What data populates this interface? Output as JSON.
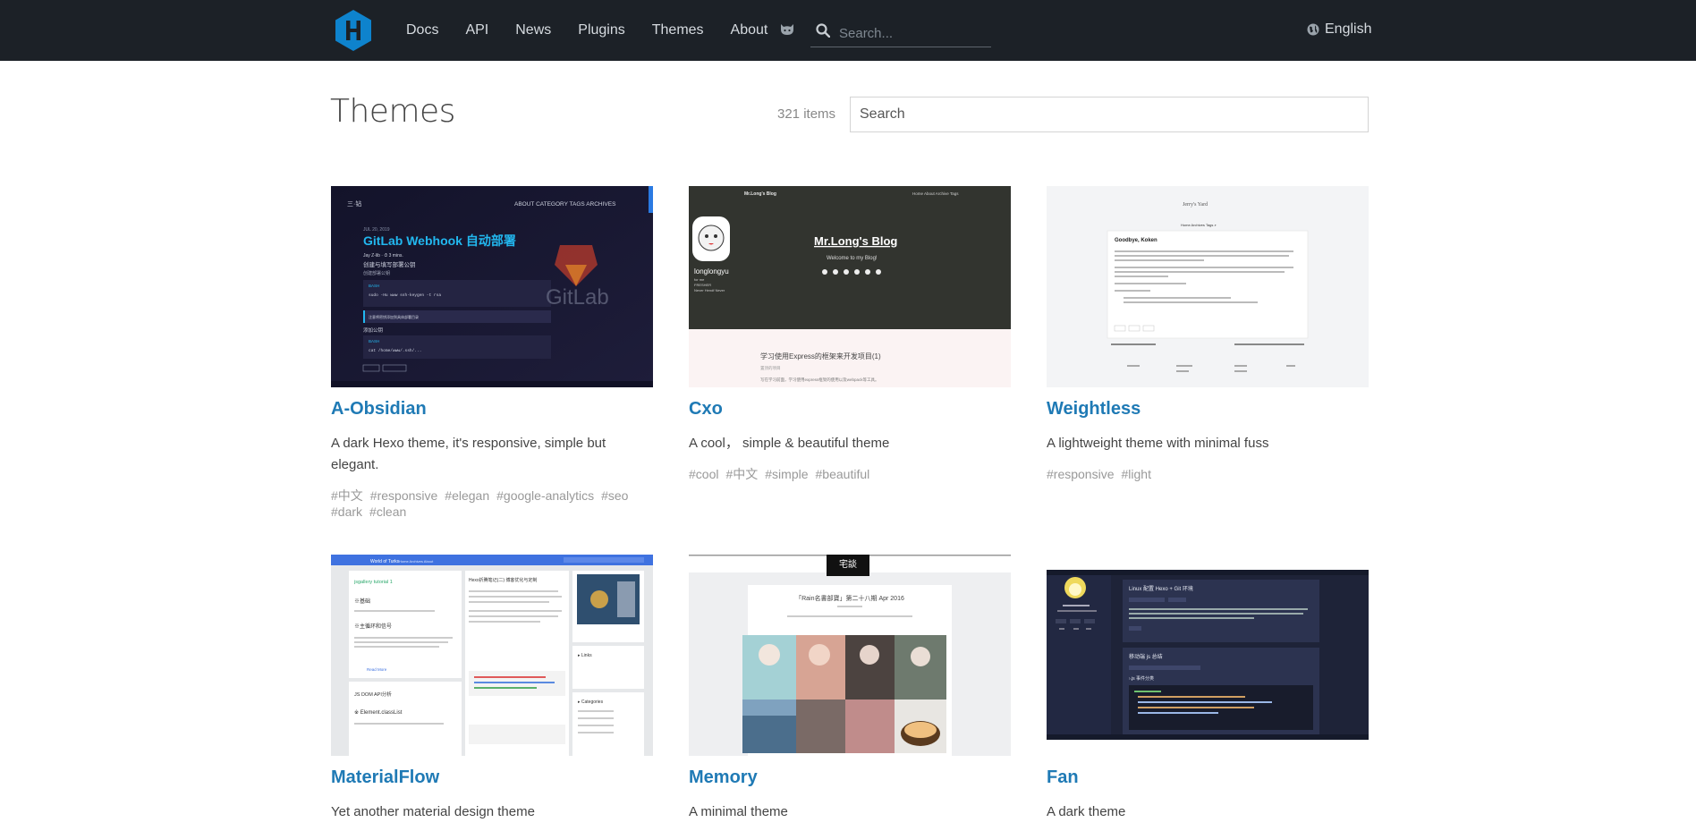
{
  "header": {
    "nav": [
      "Docs",
      "API",
      "News",
      "Plugins",
      "Themes",
      "About"
    ],
    "search_placeholder": "Search...",
    "language": "English"
  },
  "main": {
    "title": "Themes",
    "count": "321 items",
    "filter_placeholder": "Search"
  },
  "themes": [
    {
      "name": "A-Obsidian",
      "desc": "A dark Hexo theme, it's responsive, simple but elegant.",
      "tags": [
        "#中文",
        "#responsive",
        "#elegan",
        "#google-analytics",
        "#seo",
        "#dark",
        "#clean"
      ],
      "preview": {
        "nav": "ABOUT  CATEGORY  TAGS  ARCHIVES",
        "post_title": "GitLab Webhook 自动部署",
        "subtitle": "创建与填写部署公钥",
        "watermark": "GitLab"
      }
    },
    {
      "name": "Cxo",
      "desc": "A cool， simple & beautiful theme",
      "tags": [
        "#cool",
        "#中文",
        "#simple",
        "#beautiful"
      ],
      "preview": {
        "brand": "Mr.Long's Blog",
        "links": "Home About Archive Tags",
        "heading": "Mr.Long's Blog",
        "welcome": "Welcome to my Blog!",
        "author": "longlongyu",
        "post": "学习使用Express的框架来开发项目(1)"
      }
    },
    {
      "name": "Weightless",
      "desc": "A lightweight theme with minimal fuss",
      "tags": [
        "#responsive",
        "#light"
      ],
      "preview": {
        "site": "Jerry's Yard",
        "post": "Goodbye, Koken"
      }
    },
    {
      "name": "MaterialFlow",
      "desc": "Yet another material design theme",
      "tags": [],
      "preview": {
        "site": "World of Turks"
      }
    },
    {
      "name": "Memory",
      "desc": "A minimal theme",
      "tags": [],
      "preview": {
        "badge": "宅談",
        "headline": "「Rain名書部寶」第二十八期 Apr 2016"
      }
    },
    {
      "name": "Fan",
      "desc": "A dark theme",
      "tags": [],
      "preview": {
        "post1": "Linux 配置 Hexo + Git 环境",
        "post2": "移动端 js 总结"
      }
    }
  ],
  "colors": {
    "header_bg": "#1c2127",
    "link": "#1f7ab5",
    "logo": "#0e83cd"
  }
}
